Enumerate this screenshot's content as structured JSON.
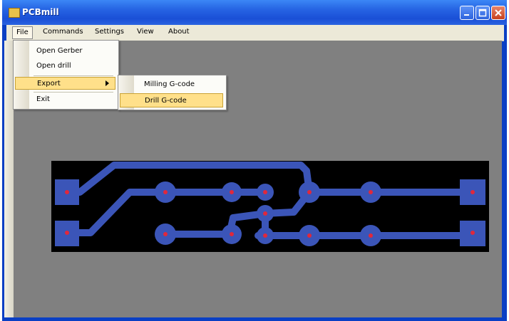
{
  "window": {
    "title": "PCBmill",
    "controls": [
      "minimize-icon",
      "maximize-icon",
      "close-icon"
    ]
  },
  "menubar": {
    "items": [
      {
        "label": "File",
        "open": true
      },
      {
        "label": "Commands"
      },
      {
        "label": "Settings"
      },
      {
        "label": "View"
      },
      {
        "label": "About"
      }
    ]
  },
  "file_menu": {
    "items": [
      {
        "label": "Open Gerber"
      },
      {
        "label": "Open drill"
      },
      {
        "label": "Export",
        "has_submenu": true,
        "highlighted": true
      },
      {
        "label": "Exit"
      }
    ]
  },
  "export_submenu": {
    "items": [
      {
        "label": "Milling G-code"
      },
      {
        "label": "Drill G-code",
        "highlighted": true
      }
    ]
  },
  "colors": {
    "board": "#000000",
    "trace": "#3b55b8",
    "drill_point": "#e0283c",
    "client_bg": "#808080",
    "highlight": "#ffe08a"
  }
}
